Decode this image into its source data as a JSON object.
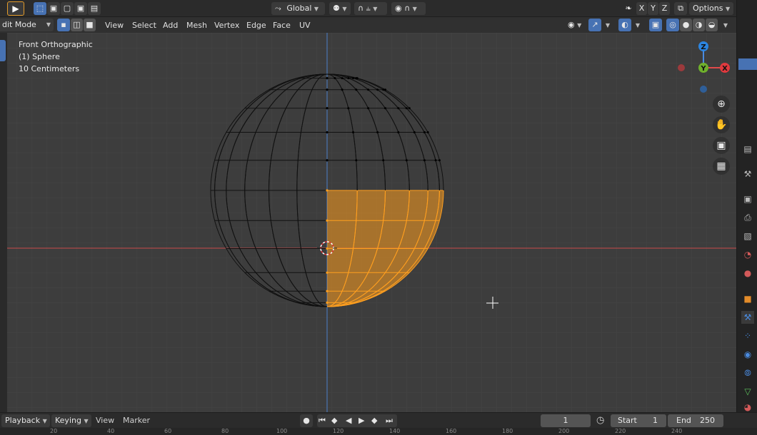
{
  "topbar": {
    "transform_orientation": "Global",
    "options_label": "Options",
    "axis_x": "X",
    "axis_y": "Y",
    "axis_z": "Z"
  },
  "header": {
    "mode": "dit Mode",
    "menus": [
      "View",
      "Select",
      "Add",
      "Mesh",
      "Vertex",
      "Edge",
      "Face",
      "UV"
    ]
  },
  "viewport": {
    "view_name": "Front Orthographic",
    "object_name": "(1) Sphere",
    "grid_scale": "10 Centimeters"
  },
  "gizmo": {
    "z": "Z",
    "y": "Y",
    "x": "X"
  },
  "timeline": {
    "menus": [
      "Playback",
      "Keying",
      "View",
      "Marker"
    ],
    "current_frame": "1",
    "start_label": "Start",
    "start_value": "1",
    "end_label": "End",
    "end_value": "250"
  },
  "ruler_ticks": [
    "20",
    "40",
    "60",
    "80",
    "100",
    "120",
    "140",
    "160",
    "180",
    "200",
    "220",
    "240"
  ],
  "colors": {
    "selected": "#ff9f1f",
    "x_axis": "#c94a4a",
    "z_axis": "#4a7fc9",
    "accent": "#4772b3"
  }
}
